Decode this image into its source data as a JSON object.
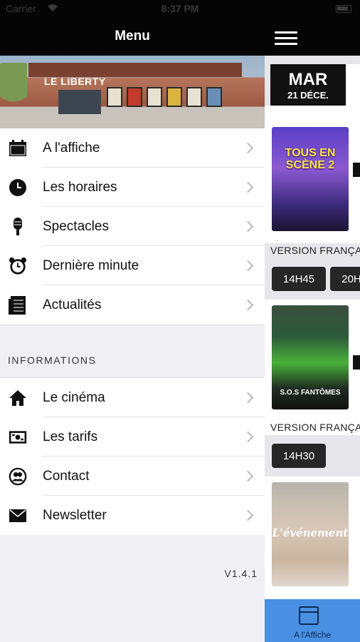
{
  "status_bar": {
    "carrier": "Carrier",
    "time": "8:37 PM"
  },
  "nav": {
    "title": "Menu"
  },
  "venue": {
    "sign": "LE LIBERTY"
  },
  "menu_primary": [
    {
      "label": "A l'affiche",
      "icon": "calendar-icon"
    },
    {
      "label": "Les horaires",
      "icon": "clock-icon"
    },
    {
      "label": "Spectacles",
      "icon": "microphone-icon"
    },
    {
      "label": "Dernière minute",
      "icon": "alarm-clock-icon"
    },
    {
      "label": "Actualités",
      "icon": "news-icon"
    }
  ],
  "informations": {
    "header": "INFORMATIONS",
    "items": [
      {
        "label": "Le cinéma",
        "icon": "home-icon"
      },
      {
        "label": "Les tarifs",
        "icon": "ticket-icon"
      },
      {
        "label": "Contact",
        "icon": "contacts-icon"
      },
      {
        "label": "Newsletter",
        "icon": "envelope-icon"
      }
    ]
  },
  "version": "V1.4.1",
  "schedule": {
    "day": {
      "weekday": "MAR",
      "date": "21 DÉCE."
    },
    "movies": [
      {
        "poster_text": "TOUS EN SCÈNE 2",
        "version": "VERSION FRANÇAISE",
        "times": [
          "14H45",
          "20H"
        ]
      },
      {
        "poster_text": "S.O.S FANTÔMES",
        "version": "VERSION FRANÇAISE",
        "times": [
          "14H30"
        ]
      },
      {
        "poster_text": "L'événement"
      }
    ]
  },
  "bottom_tab": {
    "label": "A l'Affiche",
    "color": "#4a90e2"
  }
}
